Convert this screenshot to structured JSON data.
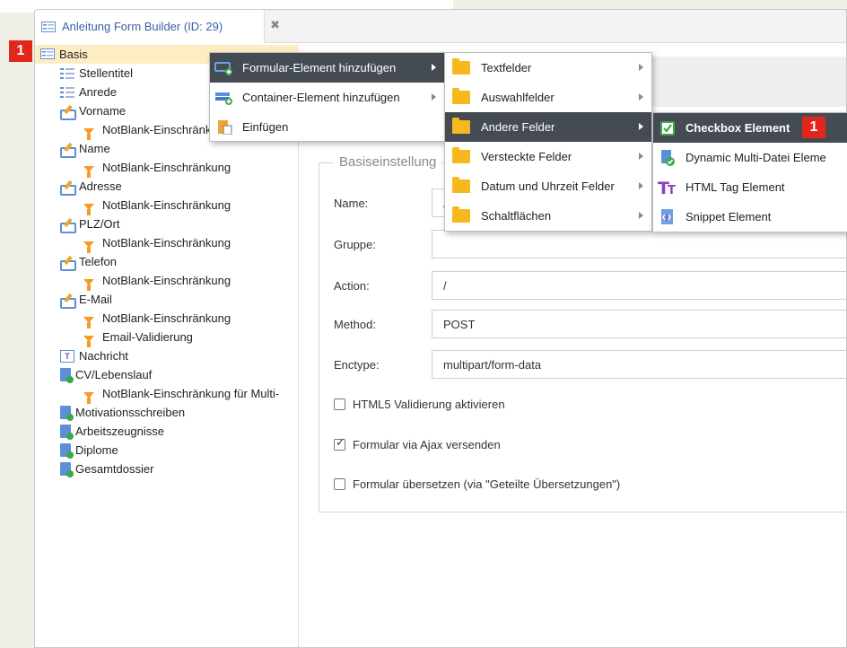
{
  "tab": {
    "title": "Anleitung Form Builder (ID: 29)",
    "close": "✖"
  },
  "tree": {
    "root": "Basis",
    "items": [
      {
        "label": "Stellentitel",
        "type": "list"
      },
      {
        "label": "Anrede",
        "type": "list"
      },
      {
        "label": "Vorname",
        "type": "pencil"
      },
      {
        "label": "NotBlank-Einschränkung",
        "type": "funnel"
      },
      {
        "label": "Name",
        "type": "pencil"
      },
      {
        "label": "NotBlank-Einschränkung",
        "type": "funnel"
      },
      {
        "label": "Adresse",
        "type": "pencil"
      },
      {
        "label": "NotBlank-Einschränkung",
        "type": "funnel"
      },
      {
        "label": "PLZ/Ort",
        "type": "pencil"
      },
      {
        "label": "NotBlank-Einschränkung",
        "type": "funnel"
      },
      {
        "label": "Telefon",
        "type": "pencil"
      },
      {
        "label": "NotBlank-Einschränkung",
        "type": "funnel"
      },
      {
        "label": "E-Mail",
        "type": "pencil"
      },
      {
        "label": "NotBlank-Einschränkung",
        "type": "funnel"
      },
      {
        "label": "Email-Validierung",
        "type": "funnel"
      },
      {
        "label": "Nachricht",
        "type": "textbox"
      },
      {
        "label": "CV/Lebenslauf",
        "type": "doc"
      },
      {
        "label": "NotBlank-Einschränkung für Multi-",
        "type": "funnel"
      },
      {
        "label": "Motivationsschreiben",
        "type": "doc"
      },
      {
        "label": "Arbeitszeugnisse",
        "type": "doc"
      },
      {
        "label": "Diplome",
        "type": "doc"
      },
      {
        "label": "Gesamtdossier",
        "type": "doc"
      }
    ]
  },
  "badges": {
    "left": "1",
    "right": "1"
  },
  "form": {
    "legend": "Basiseinstellung",
    "name_label": "Name:",
    "name_value": "A",
    "group_label": "Gruppe:",
    "group_value": "",
    "action_label": "Action:",
    "action_value": "/",
    "method_label": "Method:",
    "method_value": "POST",
    "enctype_label": "Enctype:",
    "enctype_value": "multipart/form-data",
    "cb_html5": "HTML5 Validierung aktivieren",
    "cb_html5_checked": false,
    "cb_ajax": "Formular via Ajax versenden",
    "cb_ajax_checked": true,
    "cb_translate": "Formular übersetzen (via \"Geteilte Übersetzungen\")",
    "cb_translate_checked": false
  },
  "menu1": {
    "items": [
      {
        "label": "Formular-Element hinzufügen",
        "active": true,
        "submenu": true
      },
      {
        "label": "Container-Element hinzufügen",
        "active": false,
        "submenu": true
      },
      {
        "label": "Einfügen",
        "active": false,
        "submenu": false
      }
    ]
  },
  "menu2": {
    "items": [
      {
        "label": "Textfelder",
        "active": false
      },
      {
        "label": "Auswahlfelder",
        "active": false
      },
      {
        "label": "Andere Felder",
        "active": true
      },
      {
        "label": "Versteckte Felder",
        "active": false
      },
      {
        "label": "Datum und Uhrzeit Felder",
        "active": false
      },
      {
        "label": "Schaltflächen",
        "active": false
      }
    ]
  },
  "menu3": {
    "items": [
      {
        "label": "Checkbox Element",
        "active": true
      },
      {
        "label": "Dynamic Multi-Datei Eleme",
        "active": false
      },
      {
        "label": "HTML Tag Element",
        "active": false
      },
      {
        "label": "Snippet Element",
        "active": false
      }
    ]
  },
  "colors": {
    "selected_row": "#fdedc3",
    "menu_active": "#444b52",
    "badge": "#e1261c",
    "folder": "#f5b91f",
    "link_blue": "#3a5fa8"
  }
}
